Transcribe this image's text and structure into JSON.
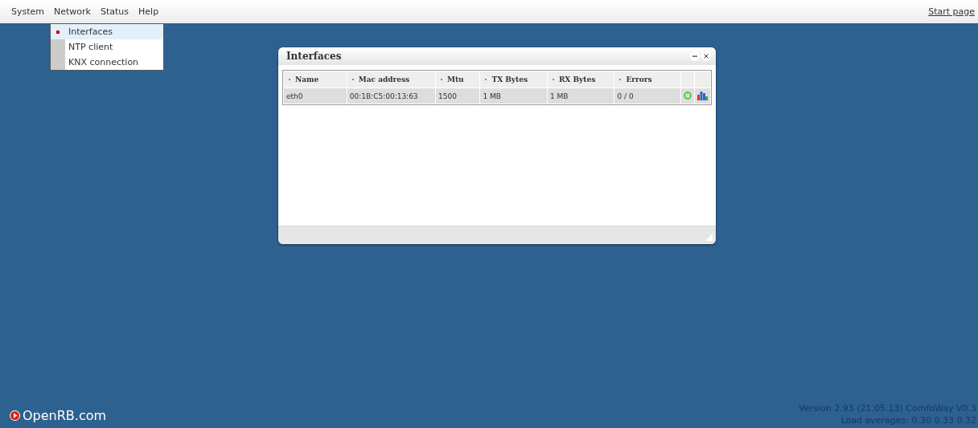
{
  "menu": [
    "System",
    "Network",
    "Status",
    "Help"
  ],
  "dropdown": [
    {
      "label": "Interfaces",
      "selected": true
    },
    {
      "label": "NTP client",
      "selected": false
    },
    {
      "label": "KNX connection",
      "selected": false
    }
  ],
  "start_link": "Start page",
  "window": {
    "title": "Interfaces",
    "table": {
      "columns": [
        "Name",
        "Mac address",
        "Mtu",
        "TX Bytes",
        "RX Bytes",
        "Errors"
      ],
      "rows": [
        {
          "cells": [
            "eth0",
            "00:1B:C5:00:13:63",
            "1500",
            "1 MB",
            "1 MB",
            "0 / 0"
          ]
        }
      ]
    }
  },
  "logo": "OpenRB.com",
  "version": "Version 2.93 (21.05.13) ComfoWay V0.3",
  "load": "Load averages: 0.30 0.33 0.32"
}
